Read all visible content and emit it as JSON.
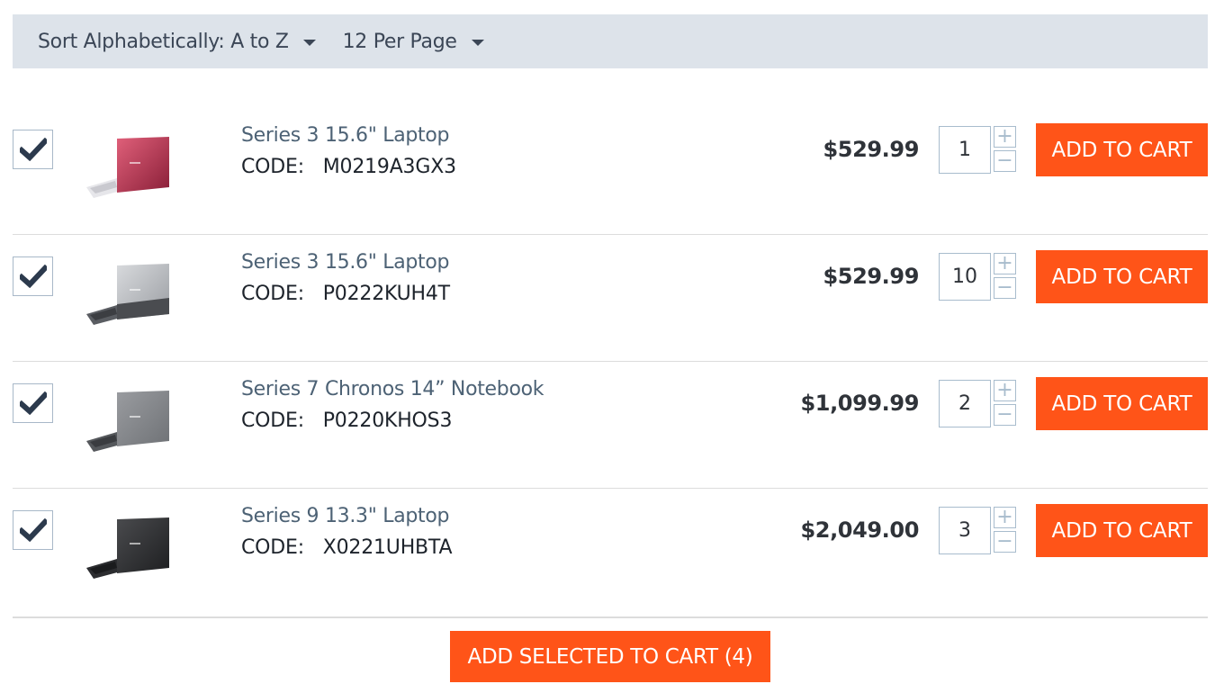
{
  "toolbar": {
    "sort_label": "Sort Alphabetically: A to Z",
    "per_page_label": "12 Per Page"
  },
  "products": [
    {
      "name": "Series 3 15.6\" Laptop",
      "code_label": "CODE:",
      "code": "M0219A3GX3",
      "price": "$529.99",
      "quantity": "1",
      "checked": true,
      "image": "laptop-red",
      "add_label": "ADD TO CART",
      "plus": "+",
      "minus": "−"
    },
    {
      "name": "Series 3 15.6\" Laptop",
      "code_label": "CODE:",
      "code": "P0222KUH4T",
      "price": "$529.99",
      "quantity": "10",
      "checked": true,
      "image": "laptop-silver",
      "add_label": "ADD TO CART",
      "plus": "+",
      "minus": "−"
    },
    {
      "name": "Series 7 Chronos 14” Notebook",
      "code_label": "CODE:",
      "code": "P0220KHOS3",
      "price": "$1,099.99",
      "quantity": "2",
      "checked": true,
      "image": "laptop-gray",
      "add_label": "ADD TO CART",
      "plus": "+",
      "minus": "−"
    },
    {
      "name": "Series 9 13.3\" Laptop",
      "code_label": "CODE:",
      "code": "X0221UHBTA",
      "price": "$2,049.00",
      "quantity": "3",
      "checked": true,
      "image": "laptop-black",
      "add_label": "ADD TO CART",
      "plus": "+",
      "minus": "−"
    }
  ],
  "add_selected_label": "ADD SELECTED TO CART (4)",
  "colors": {
    "accent": "#ff5418",
    "toolbar_bg": "#dde3ea",
    "product_name": "#4d6275",
    "checkmark": "#2c3a4d"
  }
}
